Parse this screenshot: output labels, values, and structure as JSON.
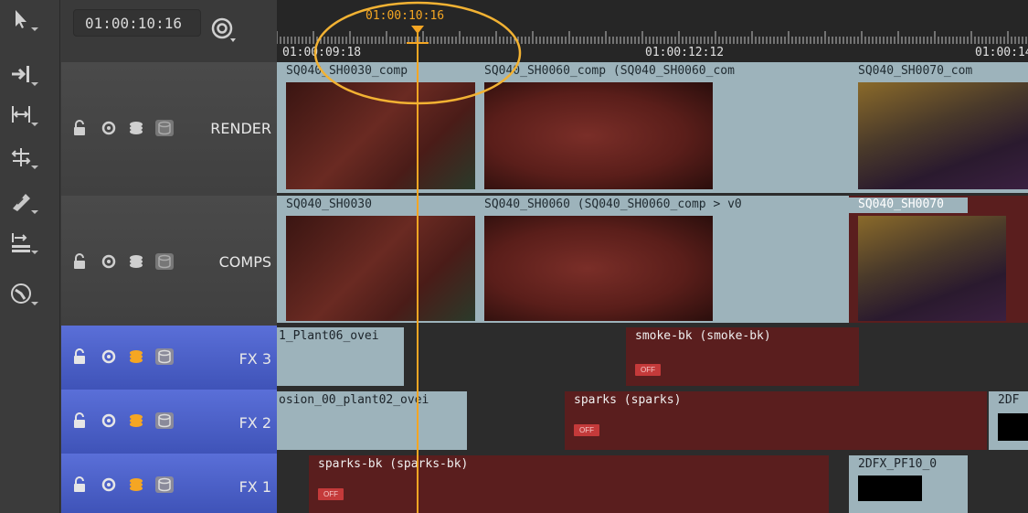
{
  "header": {
    "current_timecode": "01:00:10:16",
    "playhead_timecode": "01:00:10:16",
    "ruler_labels": [
      "01:00:09:18",
      "01:00:12:12",
      "01:00:14"
    ]
  },
  "toolbar": {
    "tools": [
      "pointer-tool",
      "track-select-tool",
      "slip-tool",
      "roll-tool",
      "razor-tool",
      "retime-tool",
      "zoom-tool"
    ]
  },
  "tracks": [
    {
      "label": "RENDER",
      "clips": [
        {
          "title": "SQ040_SH0030_comp"
        },
        {
          "title": "SQ040_SH0060_comp (SQ040_SH0060_com"
        },
        {
          "title": "SQ040_SH0070_com"
        }
      ]
    },
    {
      "label": "COMPS",
      "clips": [
        {
          "title": "SQ040_SH0030"
        },
        {
          "title": "SQ040_SH0060 (SQ040_SH0060_comp > v0"
        },
        {
          "title": "SQ040_SH0070"
        }
      ]
    },
    {
      "label": "FX 3",
      "clips": [
        {
          "title": "1_Plant06_ovei"
        },
        {
          "title": "smoke-bk (smoke-bk)",
          "badge": "OFF"
        }
      ]
    },
    {
      "label": "FX 2",
      "clips": [
        {
          "title": "osion_00_plant02_ovei"
        },
        {
          "title": "sparks (sparks)",
          "badge": "OFF"
        },
        {
          "title": "2DF"
        }
      ]
    },
    {
      "label": "FX 1",
      "clips": [
        {
          "title": "sparks-bk (sparks-bk)",
          "badge": "OFF"
        },
        {
          "title": "2DFX_PF10_0"
        }
      ]
    }
  ],
  "colors": {
    "playhead": "#f5a623",
    "fx_track_header": "#4a5fcc",
    "disabled_clip": "#5a1e1e",
    "clip_blue": "#9db3bb"
  }
}
